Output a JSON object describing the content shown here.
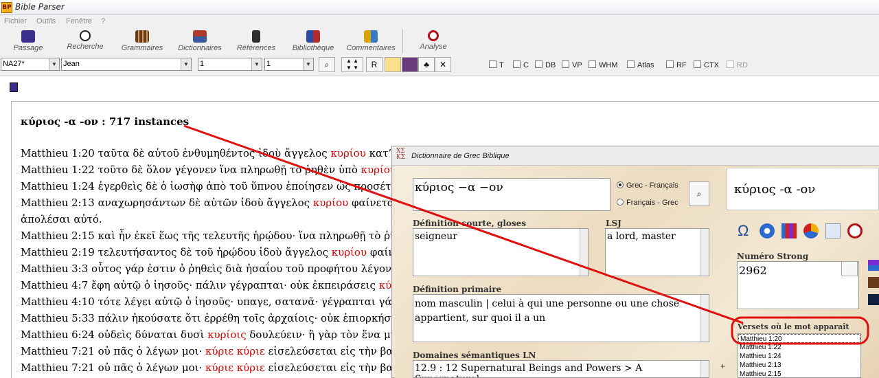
{
  "window": {
    "title": "Bible Parser",
    "icon_text": "BP"
  },
  "menu": [
    "Fichier",
    "Outils",
    "Fenêtre",
    "?"
  ],
  "toolbar": [
    {
      "label": "Passage",
      "icon": "passage-icon",
      "color": "#3a2f8f"
    },
    {
      "label": "Recherche",
      "icon": "search-icon",
      "color": "#2a2a2a"
    },
    {
      "label": "Grammaires",
      "icon": "grammar-books-icon",
      "color": "#6a3a1a"
    },
    {
      "label": "Dictionnaires",
      "icon": "dictionary-icon",
      "color": "#b03a2a"
    },
    {
      "label": "Références",
      "icon": "references-icon",
      "color": "#2d2d2d"
    },
    {
      "label": "Bibliothèque",
      "icon": "library-icon",
      "color": "#2e4aa0"
    },
    {
      "label": "Commentaires",
      "icon": "comments-icon",
      "color": "#d8a400"
    },
    {
      "label": "Analyse",
      "icon": "analysis-icon",
      "color": "#b0121a"
    }
  ],
  "selectors": {
    "version": "NA27*",
    "book": "Jean",
    "chapter": "1",
    "verse": "1",
    "r_button": "R"
  },
  "checkboxes": [
    "T",
    "C",
    "DB",
    "VP",
    "WHM",
    "Atlas",
    "RF",
    "CTX",
    "RD"
  ],
  "reader": {
    "heading": "κύριος -α -ον : 717 instances",
    "verses": [
      {
        "ref": "Matthieu 1:20",
        "pre": " ταῦτα δὲ αὐτοῦ ἐνθυμηθέντος ἰδοὺ ἄγγελος ",
        "hl": "κυρίου",
        "post": " κατ’ ὄναρ"
      },
      {
        "ref": "Matthieu 1:22",
        "pre": " τοῦτο δὲ ὅλον γέγονεν ἵνα πληρωθῇ τὸ ῥηθὲν ὑπὸ ",
        "hl": "κυρίου",
        "post": " διὰ"
      },
      {
        "ref": "Matthieu 1:24",
        "pre": " ἐγερθεὶς δὲ ὁ ἰωσὴφ ἀπὸ τοῦ ὕπνου ἐποίησεν ὡς προσέταξεν",
        "hl": "",
        "post": ""
      },
      {
        "ref": "Matthieu 2:13",
        "pre": " αναχωρησάντων δὲ αὐτῶν ἰδοὺ ἄγγελος ",
        "hl": "κυρίου",
        "post": " φαίνεται κατ’"
      },
      {
        "ref": "",
        "pre": "ἀπολέσαι αὐτό.",
        "hl": "",
        "post": ""
      },
      {
        "ref": "Matthieu 2:15",
        "pre": " καὶ ἦν ἐκεῖ ἕως τῆς τελευτῆς ἡρῴδου· ἵνα πληρωθῇ τὸ ῥηθὲν",
        "hl": "",
        "post": ""
      },
      {
        "ref": "Matthieu 2:19",
        "pre": " τελευτήσαντος δὲ τοῦ ἡρῴδου ἰδοὺ ἄγγελος ",
        "hl": "κυρίου",
        "post": " φαίνεται"
      },
      {
        "ref": "Matthieu 3:3",
        "pre": " οὗτος γάρ ἐστιν ὁ ῥηθεὶς διὰ ἠσαΐου τοῦ προφήτου λέγοντος·",
        "hl": "",
        "post": ""
      },
      {
        "ref": "Matthieu 4:7",
        "pre": " ἔφη αὐτῷ ὁ ἰησοῦς· πάλιν γέγραπται· οὐκ ἐκπειράσεις ",
        "hl": "κύριον",
        "post": ""
      },
      {
        "ref": "Matthieu 4:10",
        "pre": " τότε λέγει αὐτῷ ὁ ἰησοῦς· υπαγε, σατανᾶ· γέγραπται γάρ·",
        "hl": "",
        "post": ""
      },
      {
        "ref": "Matthieu 5:33",
        "pre": " πάλιν ἠκούσατε ὅτι ἐρρέθη τοῖς ἀρχαίοις· οὐκ ἐπιορκήσεις, ἀπο",
        "hl": "",
        "post": ""
      },
      {
        "ref": "Matthieu 6:24",
        "pre": " οὐδεὶς δύναται δυσὶ ",
        "hl": "κυρίοις",
        "post": " δουλεύειν· ἢ γὰρ τὸν ἕνα μισήσει"
      },
      {
        "ref": "Matthieu 7:21",
        "pre": " οὐ πᾶς ὁ λέγων μοι· ",
        "hl": "κύριε κύριε",
        "post": " εἰσελεύσεται εἰς τὴν βασιλεία"
      },
      {
        "ref": "Matthieu 7:21",
        "pre": " οὐ πᾶς ὁ λέγων μοι· ",
        "hl": "κύριε κύριε",
        "post": " εἰσελεύσεται εἰς τὴν βασιλεία"
      }
    ]
  },
  "dictionary": {
    "title": "Dictionnaire de Grec Biblique",
    "title_glyph": "ΧΣ\nΚΣ",
    "search_value": "κύριος −α −ον",
    "radio_gf": "Grec - Français",
    "radio_fg": "Français - Grec",
    "headword": "κύριος -α -ον",
    "short_def_label": "Définition courte, gloses",
    "short_def": "seigneur",
    "lsj_label": "LSJ",
    "lsj": "a lord, master",
    "primary_label": "Définition primaire",
    "primary": "nom masculin  | celui à qui une personne ou une chose appartient, sur quoi il a un",
    "ln_label": "Domaines sémantiques LN",
    "ln": "12.9 : 12 Supernatural Beings and Powers > A Supernatural",
    "strong_label": "Numéro Strong",
    "strong": "2962",
    "verses_label": "Versets où le mot apparaît",
    "verses_list": [
      "Matthieu 1:20",
      "Matthieu 1:22",
      "Matthieu 1:24",
      "Matthieu 2:13",
      "Matthieu 2:15"
    ],
    "plus": "+"
  },
  "colors": {
    "highlight": "#d40000",
    "annotation": "#e01010"
  }
}
